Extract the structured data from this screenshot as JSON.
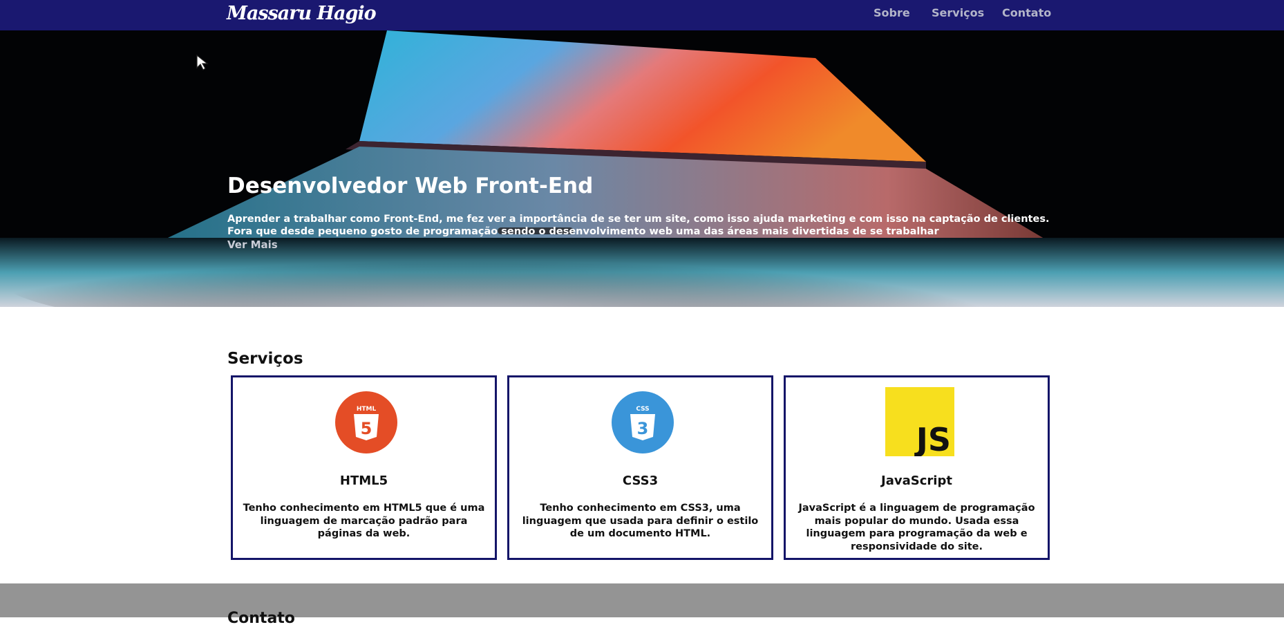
{
  "nav": {
    "brand": "Massaru Hagio",
    "links": [
      "Sobre",
      "Serviços",
      "Contato"
    ]
  },
  "hero": {
    "title": "Desenvolvedor Web Front-End",
    "text": "Aprender a trabalhar como Front-End, me fez ver a importância de se ter um site, como isso ajuda marketing e com isso na captação de clientes. Fora que desde pequeno gosto de programação sendo o desenvolvimento web uma das áreas mais divertidas de se trabalhar",
    "link": "Ver Mais"
  },
  "services": {
    "title": "Serviços",
    "cards": [
      {
        "icon": "html5-icon",
        "icon_badge": "HTML",
        "icon_glyph": "5",
        "icon_color": "#e44d26",
        "title": "HTML5",
        "text": "Tenho conhecimento em HTML5 que é uma linguagem de marcação padrão para páginas da web."
      },
      {
        "icon": "css3-icon",
        "icon_badge": "CSS",
        "icon_glyph": "3",
        "icon_color": "#3a95d9",
        "title": "CSS3",
        "text": "Tenho conhecimento em CSS3, uma linguagem que usada para definir o estilo de um documento HTML."
      },
      {
        "icon": "javascript-icon",
        "icon_glyph": "JS",
        "icon_color": "#f7df1e",
        "title": "JavaScript",
        "text": "JavaScript é a linguagem de programação mais popular do mundo. Usada essa linguagem para programação da web e responsividade do site."
      }
    ]
  },
  "contact": {
    "title": "Contato"
  },
  "colors": {
    "navbar": "#1a1870",
    "card_border": "#141568",
    "contact_bg": "#949494"
  }
}
